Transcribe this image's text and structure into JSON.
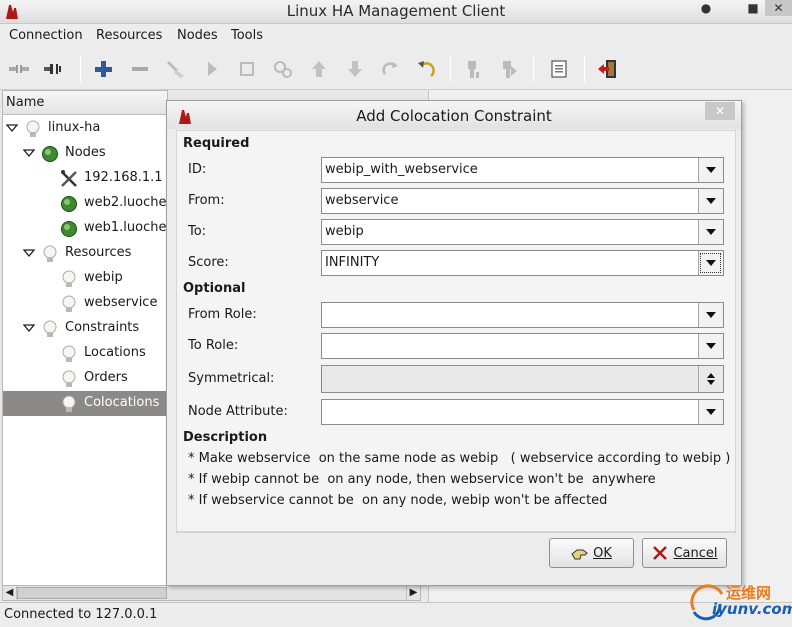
{
  "window": {
    "title": "Linux HA Management Client",
    "minimize": "●",
    "maximize": "■",
    "close": "✕"
  },
  "menu": [
    "Connection",
    "Resources",
    "Nodes",
    "Tools"
  ],
  "toolbar": {
    "icons": [
      "connect-icon",
      "disconnect-icon",
      "add-icon",
      "remove-icon",
      "cleanup-icon",
      "start-icon",
      "stop-icon",
      "default-icon",
      "move-up-icon",
      "move-down-icon",
      "redo-icon",
      "undo-icon",
      "standby-icon",
      "active-icon",
      "xml-view-icon",
      "exit-icon"
    ]
  },
  "tree": {
    "header": "Name",
    "items": [
      {
        "label": "linux-ha",
        "icon": "bulb-icon",
        "level": 0,
        "expanded": true
      },
      {
        "label": "Nodes",
        "icon": "green-node-icon",
        "level": 1,
        "expanded": true
      },
      {
        "label": "192.168.1.1",
        "icon": "tools-icon",
        "level": 2
      },
      {
        "label": "web2.luoche",
        "icon": "green-node-icon",
        "level": 2
      },
      {
        "label": "web1.luoche",
        "icon": "green-node-icon",
        "level": 2
      },
      {
        "label": "Resources",
        "icon": "bulb-icon",
        "level": 1,
        "expanded": true
      },
      {
        "label": "webip",
        "icon": "bulb-icon",
        "level": 2
      },
      {
        "label": "webservice",
        "icon": "bulb-icon",
        "level": 2
      },
      {
        "label": "Constraints",
        "icon": "bulb-icon",
        "level": 1,
        "expanded": true
      },
      {
        "label": "Locations",
        "icon": "bulb-icon",
        "level": 2
      },
      {
        "label": "Orders",
        "icon": "bulb-icon",
        "level": 2
      },
      {
        "label": "Colocations",
        "icon": "bulb-icon",
        "level": 2,
        "selected": true
      }
    ]
  },
  "status": {
    "text": "Connected to 127.0.0.1"
  },
  "dialog": {
    "title": "Add Colocation Constraint",
    "close": "✕",
    "required_label": "Required",
    "optional_label": "Optional",
    "description_label": "Description",
    "fields": {
      "id": {
        "label": "ID:",
        "value": "webip_with_webservice"
      },
      "from": {
        "label": "From:",
        "value": "webservice"
      },
      "to": {
        "label": "To:",
        "value": "webip"
      },
      "score": {
        "label": "Score:",
        "value": "INFINITY"
      },
      "from_role": {
        "label": "From Role:",
        "value": ""
      },
      "to_role": {
        "label": "To Role:",
        "value": ""
      },
      "symmetrical": {
        "label": "Symmetrical:",
        "value": ""
      },
      "node_attribute": {
        "label": "Node Attribute:",
        "value": ""
      }
    },
    "description": [
      "* Make webservice  on the same node as webip   ( webservice according to webip )",
      "* If webip cannot be  on any node, then webservice won't be  anywhere",
      "* If webservice cannot be  on any node, webip won't be affected"
    ],
    "ok_label": "OK",
    "cancel_label": "Cancel"
  },
  "watermark": {
    "top": "运维网",
    "bottom": "iyunv.com"
  },
  "colors": {
    "selection": "#8b8a86",
    "node_green": "#3e8a2e",
    "bulb": "#f4f4ea"
  }
}
